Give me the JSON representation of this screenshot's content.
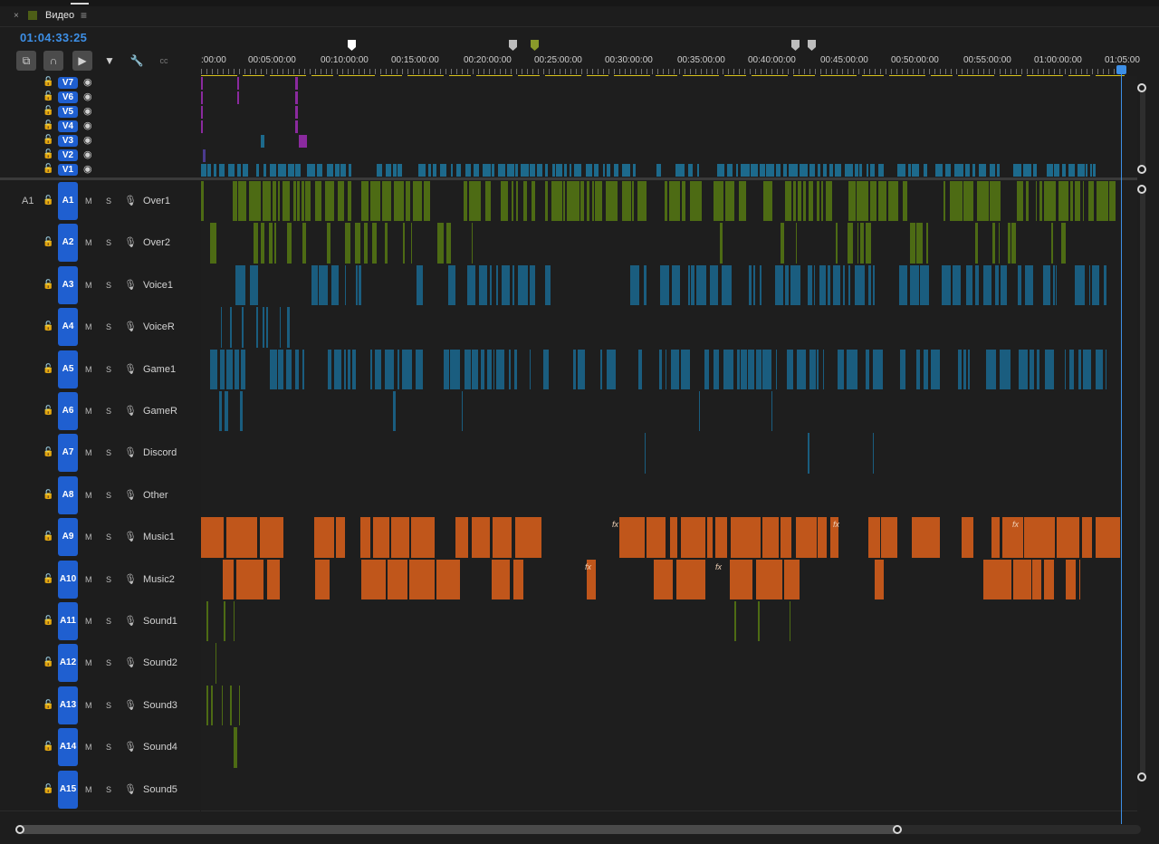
{
  "panel": {
    "title": "Видео",
    "close_glyph": "×",
    "menu_glyph": "≡"
  },
  "timecode": "01:04:33:25",
  "tools": [
    {
      "name": "insert-sequence-nested-icon",
      "glyph": "⧉"
    },
    {
      "name": "snap-magnet-icon",
      "glyph": "∩"
    },
    {
      "name": "linked-selection-icon",
      "glyph": "▶"
    },
    {
      "name": "add-marker-icon",
      "glyph": "▼"
    },
    {
      "name": "wrench-settings-icon",
      "glyph": "🔧"
    },
    {
      "name": "captions-icon",
      "glyph": "cc"
    }
  ],
  "ruler": {
    "labels": [
      ":00:00",
      "00:05:00:00",
      "00:10:00:00",
      "00:15:00:00",
      "00:20:00:00",
      "00:25:00:00",
      "00:30:00:00",
      "00:35:00:00",
      "00:40:00:00",
      "00:45:00:00",
      "00:50:00:00",
      "00:55:00:00",
      "01:00:00:00",
      "01:05:00"
    ],
    "markers": [
      {
        "name": "marker-white-icon",
        "color": "#ffffff"
      },
      {
        "name": "marker-gray-icon",
        "color": "#bdbdbd"
      },
      {
        "name": "marker-olive-icon",
        "color": "#8a9a2a"
      },
      {
        "name": "marker-gray-icon",
        "color": "#bdbdbd"
      },
      {
        "name": "marker-gray-icon",
        "color": "#bdbdbd"
      }
    ]
  },
  "video_tracks": [
    {
      "id": "V7"
    },
    {
      "id": "V6"
    },
    {
      "id": "V5"
    },
    {
      "id": "V4"
    },
    {
      "id": "V3"
    },
    {
      "id": "V2"
    },
    {
      "id": "V1"
    }
  ],
  "audio_source_patch": "A1",
  "audio_tracks": [
    {
      "id": "A1",
      "name": "Over1"
    },
    {
      "id": "A2",
      "name": "Over2"
    },
    {
      "id": "A3",
      "name": "Voice1"
    },
    {
      "id": "A4",
      "name": "VoiceR"
    },
    {
      "id": "A5",
      "name": "Game1"
    },
    {
      "id": "A6",
      "name": "GameR"
    },
    {
      "id": "A7",
      "name": "Discord"
    },
    {
      "id": "A8",
      "name": "Other"
    },
    {
      "id": "A9",
      "name": "Music1"
    },
    {
      "id": "A10",
      "name": "Music2"
    },
    {
      "id": "A11",
      "name": "Sound1"
    },
    {
      "id": "A12",
      "name": "Sound2"
    },
    {
      "id": "A13",
      "name": "Sound3"
    },
    {
      "id": "A14",
      "name": "Sound4"
    },
    {
      "id": "A15",
      "name": "Sound5"
    }
  ],
  "track_buttons": {
    "mute": "M",
    "solo": "S",
    "fx_label": "fx"
  },
  "colors": {
    "accent": "#3d8fe6",
    "badge": "#1f5fd0",
    "video_clip": "#1d6a8c",
    "audio_green": "#4d6b14",
    "audio_blue": "#1a5d7f",
    "music_orange": "#c0561b",
    "purple": "#8a2a9e",
    "work_area_yellow": "#d8c21a"
  }
}
